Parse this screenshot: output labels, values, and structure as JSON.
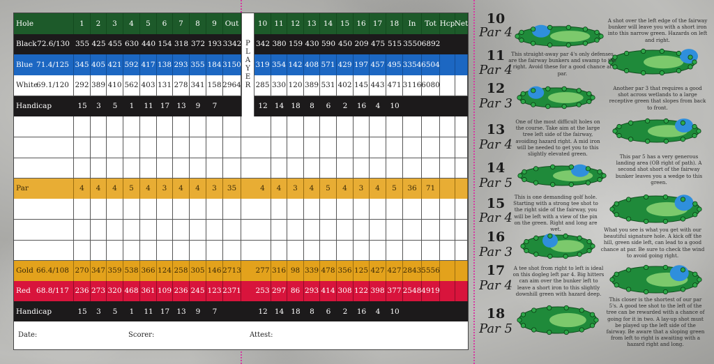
{
  "scorecard": {
    "front_holes": [
      "1",
      "2",
      "3",
      "4",
      "5",
      "6",
      "7",
      "8",
      "9"
    ],
    "back_holes": [
      "10",
      "11",
      "12",
      "13",
      "14",
      "15",
      "16",
      "17",
      "18"
    ],
    "header": {
      "label": "Hole",
      "out": "Out",
      "in": "In",
      "tot": "Tot",
      "hcp": "Hcp",
      "net": "Net"
    },
    "player_label": [
      "P",
      "L",
      "A",
      "Y",
      "E",
      "R"
    ],
    "tees": {
      "black": {
        "name": "Black",
        "rating": "72.6/130",
        "front": [
          "355",
          "425",
          "455",
          "630",
          "440",
          "154",
          "318",
          "372",
          "193"
        ],
        "out": "3342",
        "back": [
          "342",
          "380",
          "159",
          "430",
          "590",
          "450",
          "209",
          "475",
          "515"
        ],
        "in": "3550",
        "tot": "6892"
      },
      "blue": {
        "name": "Blue",
        "rating": "71.4/125",
        "front": [
          "345",
          "405",
          "421",
          "592",
          "417",
          "138",
          "293",
          "355",
          "184"
        ],
        "out": "3150",
        "back": [
          "319",
          "354",
          "142",
          "408",
          "571",
          "429",
          "197",
          "457",
          "495"
        ],
        "in": "3354",
        "tot": "6504"
      },
      "white": {
        "name": "White",
        "rating": "69.1/120",
        "front": [
          "292",
          "389",
          "410",
          "562",
          "403",
          "131",
          "278",
          "341",
          "158"
        ],
        "out": "2964",
        "back": [
          "285",
          "330",
          "120",
          "389",
          "531",
          "402",
          "145",
          "443",
          "471"
        ],
        "in": "3116",
        "tot": "6080"
      },
      "gold": {
        "name": "Gold",
        "rating": "66.4/108",
        "front": [
          "270",
          "347",
          "359",
          "538",
          "366",
          "124",
          "258",
          "305",
          "146"
        ],
        "out": "2713",
        "back": [
          "277",
          "316",
          "98",
          "339",
          "478",
          "356",
          "125",
          "427",
          "427"
        ],
        "in": "2843",
        "tot": "5556"
      },
      "red": {
        "name": "Red",
        "rating": "68.8/117",
        "front": [
          "236",
          "273",
          "320",
          "468",
          "361",
          "109",
          "236",
          "245",
          "123"
        ],
        "out": "2371",
        "back": [
          "253",
          "297",
          "86",
          "293",
          "414",
          "308",
          "122",
          "398",
          "377"
        ],
        "in": "2548",
        "tot": "4919"
      }
    },
    "handicap": {
      "label": "Handicap",
      "front": [
        "15",
        "3",
        "5",
        "1",
        "11",
        "17",
        "13",
        "9",
        "7"
      ],
      "back": [
        "12",
        "14",
        "18",
        "8",
        "6",
        "2",
        "16",
        "4",
        "10"
      ]
    },
    "par": {
      "label": "Par",
      "front": [
        "4",
        "4",
        "4",
        "5",
        "4",
        "3",
        "4",
        "4",
        "3"
      ],
      "out": "35",
      "back": [
        "4",
        "4",
        "3",
        "4",
        "5",
        "4",
        "3",
        "4",
        "5"
      ],
      "in": "36",
      "tot": "71"
    },
    "footer": {
      "date": "Date:",
      "scorer": "Scorer:",
      "attest": "Attest:"
    },
    "colors": {
      "hole": "#1d5a2a",
      "black": "#1c1a1b",
      "blue": "#1c67c2",
      "par": "#e8ad34",
      "gold": "#e3a21c",
      "red": "#d8143c",
      "fold_line": "#d43aa0"
    }
  },
  "hole_guide": [
    {
      "hole": "10",
      "par": "Par 4",
      "text": "A shot over the left edge of the fairway bunker will leave you with a short iron into this narrow green. Hazards on left and right."
    },
    {
      "hole": "11",
      "par": "Par 4",
      "text": "This straight-away par 4's only defenses are the fairway bunkers and swamp to the right.  Avoid these for a good chance at par."
    },
    {
      "hole": "12",
      "par": "Par 3",
      "text": "Another par 3 that requires a good shot across wetlands to a large receptive green that slopes from back to front."
    },
    {
      "hole": "13",
      "par": "Par 4",
      "text": "One of the most difficult holes on the course.  Take aim at the large tree left side of the fairway, avoiding hazard right.  A mid iron will be needed to get you to this slightly elevated green."
    },
    {
      "hole": "14",
      "par": "Par 5",
      "text": "This par 5 has a very generous landing area (OB right of path).  A second shot short of the fairway bunker leaves you a wedge to this green."
    },
    {
      "hole": "15",
      "par": "Par 4",
      "text": "This is one demanding golf hole. Starting with a strong tee shot to the right side of the fairway, you will be left with a view of the pin on the green.  Right and long are wet."
    },
    {
      "hole": "16",
      "par": "Par 3",
      "text": "What you see is what you get with our beautiful signature hole.  A kick off the hill, green side left, can lead to a good chance at par.  Be sure to check the wind to avoid going right."
    },
    {
      "hole": "17",
      "par": "Par 4",
      "text": "A tee shot from right to left is ideal on this dogleg left par 4.  Big hitters can aim over the bunker left to leave a short iron to this slightly downhill green with hazard deep."
    },
    {
      "hole": "18",
      "par": "Par 5",
      "text": "This closer is the shortest of our par 5's.  A good tee shot to the left of the tree can be rewarded with a chance of going for it in two.  A lay-up shot must be played up the left side of the fairway.  Be aware that a sloping green from left to right is awaiting with a hazard right and long."
    }
  ]
}
